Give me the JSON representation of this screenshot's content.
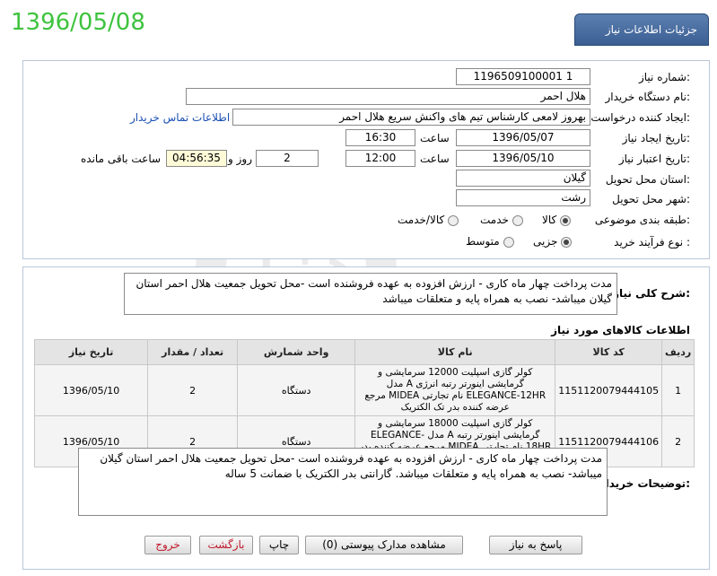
{
  "header": {
    "title": "جزئیات اطلاعات نیاز",
    "date_stamp": "1396/05/08"
  },
  "form": {
    "need_number_label": "شماره نیاز:",
    "need_number": "1196509100001 1",
    "buyer_org_label": "نام دستگاه خریدار:",
    "buyer_org": "هلال احمر",
    "requester_label": "ایجاد کننده درخواست:",
    "requester": "بهروز لامعی کارشناس تیم های واکنش سریع هلال احمر",
    "contact_link": "اطلاعات تماس خریدار",
    "announce_date_label": "تاریخ ایجاد نیاز:",
    "announce_date": "1396/05/07",
    "time_label": "ساعت",
    "announce_time": "16:30",
    "validity_date_label": "تاریخ اعتبار نیاز:",
    "validity_date": "1396/05/10",
    "validity_time": "12:00",
    "days_value": "2",
    "days_label": "روز و",
    "remaining_time": "04:56:35",
    "remaining_label": "ساعت باقی مانده",
    "province_label": "استان محل تحویل:",
    "province": "گیلان",
    "city_label": "شهر محل تحویل:",
    "city": "رشت",
    "category_label": "طبقه بندی موضوعی:",
    "category_options": [
      "کالا",
      "خدمت",
      "کالا/خدمت"
    ],
    "category_selected": "کالا",
    "process_label": "نوع فرآیند خرید :",
    "process_options": [
      "جزیی",
      "متوسط"
    ],
    "process_selected": "جزیی"
  },
  "description": {
    "label": "شرح کلی نیاز:",
    "text_line1": "مدت پرداخت چهار ماه کاری - ارزش افزوده به عهده فروشنده است -محل تحویل جمعیت هلال احمر استان",
    "text_line2": "گیلان میباشد- نصب به همراه پایه و متعلقات میباشد"
  },
  "items": {
    "section_title": "اطلاعات کالاهای مورد نیاز",
    "columns": [
      "ردیف",
      "کد کالا",
      "نام کالا",
      "واحد شمارش",
      "تعداد / مقدار",
      "تاریخ نیاز"
    ],
    "rows": [
      {
        "row": "1",
        "code": "1151120079444105",
        "name": "کولر گازی اسپلیت 12000 سرمایشی و گرمایشی اینورتر رتبه انرژی A مدل ELEGANCE-12HR نام تجارتی MIDEA مرجع عرضه کننده بدر تک الکتریک",
        "unit": "دستگاه",
        "qty": "2",
        "date": "1396/05/10"
      },
      {
        "row": "2",
        "code": "1151120079444106",
        "name": "کولر گازی اسپلیت 18000 سرمایشی و گرمایشی اینورتر رتبه A مدل ELEGANCE-18HR نام تجارتی MIDEA مرجع عرضه کننده بدر تک الکتریک",
        "unit": "دستگاه",
        "qty": "2",
        "date": "1396/05/10"
      }
    ]
  },
  "buyer_notes": {
    "label": "توضیحات خریدار:",
    "text_line1": "مدت پرداخت چهار ماه کاری - ارزش افزوده به عهده فروشنده است -محل تحویل جمعیت هلال احمر استان گیلان",
    "text_line2": "میباشد- نصب به همراه پایه و متعلقات میباشد. گارانتی بدر الکتریک با ضمانت 5 ساله"
  },
  "buttons": {
    "reply": "پاسخ به نیاز",
    "attachments": "مشاهده مدارک پیوستی (0)",
    "print": "چاپ",
    "back": "بازگشت",
    "exit": "خروج"
  },
  "watermark_text": "هزاره"
}
